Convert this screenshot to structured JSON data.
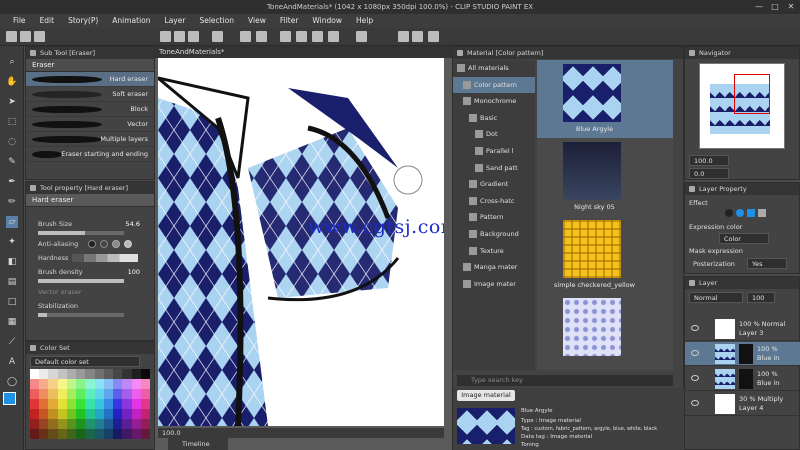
{
  "window": {
    "title": "ToneAndMaterials* (1042 x 1080px 350dpi 100.0%) - CLIP STUDIO PAINT EX",
    "controls": [
      "—",
      "□",
      "✕"
    ]
  },
  "menu": [
    "File",
    "Edit",
    "Story(P)",
    "Animation",
    "Layer",
    "Selection",
    "View",
    "Filter",
    "Window",
    "Help"
  ],
  "subtool": {
    "header": "Sub Tool [Eraser]",
    "tab": "Eraser",
    "items": [
      "Hard eraser",
      "Soft eraser",
      "Block",
      "Vector",
      "Multiple layers",
      "Eraser starting and ending"
    ]
  },
  "toolprop": {
    "header": "Tool property [Hard eraser]",
    "name": "Hard eraser",
    "brush_size_label": "Brush Size",
    "brush_size": "54.6",
    "brush_size_fill": 0.55,
    "anti_aliasing_label": "Anti-aliasing",
    "hardness_label": "Hardness",
    "density_label": "Brush density",
    "density": "100",
    "vector_eraser_label": "Vector eraser",
    "stabilization_label": "Stabilization",
    "stabilization_fill": 0.1
  },
  "colorset": {
    "header": "Color Set",
    "name": "Default color set"
  },
  "canvas": {
    "tab": "ToneAndMaterials*",
    "watermark": "www.cgtsj.com",
    "zoom": "100.0",
    "timeline_tab": "Timeline"
  },
  "material": {
    "header": "Material [Color pattern]",
    "tree": [
      "All materials",
      "Color pattern",
      "Monochrome",
      "Basic",
      "Dot",
      "Parallel l",
      "Sand patt",
      "Gradient",
      "Cross-hatc",
      "Pattern",
      "Background",
      "Texture",
      "Manga mater",
      "Image mater"
    ],
    "thumbnails": [
      {
        "label": "Blue Argyle"
      },
      {
        "label": "Night sky 05"
      },
      {
        "label": "simple checkered_yellow"
      },
      {
        "label": ""
      }
    ],
    "search_placeholder": "Type search key",
    "image_material_button": "Image material",
    "detail": {
      "name": "Blue Argyle",
      "type": "Type : Image material",
      "tag": "Tag : custom, fabric_pattern, argyle, blue, white, black",
      "data_tag": "Data tag : Image material",
      "toning": "Toning"
    }
  },
  "navigator": {
    "header": "Navigator",
    "zoom": "100.0",
    "angle": "0.0"
  },
  "layer_property": {
    "header": "Layer Property",
    "effect_label": "Effect",
    "expression_color_label": "Expression color",
    "color_value": "Color",
    "mask_label": "Mask expression",
    "posterization_label": "Posterization",
    "posterization_value": "Yes"
  },
  "layers": {
    "header": "Layer",
    "blend_mode": "Normal",
    "opacity": "100",
    "rows": [
      {
        "line1": "100 %  Normal",
        "line2": "Layer 3"
      },
      {
        "line1": "100 %",
        "line2": "Blue in"
      },
      {
        "line1": "100 %",
        "line2": "Blue in"
      },
      {
        "line1": "30 %  Multiply",
        "line2": "Layer 4"
      }
    ]
  },
  "colors": {
    "accent": "#1e6fd9",
    "argyle_dark": "#1a1f6b",
    "argyle_light": "#a9d3f0",
    "current_color": "#1e90e6"
  }
}
